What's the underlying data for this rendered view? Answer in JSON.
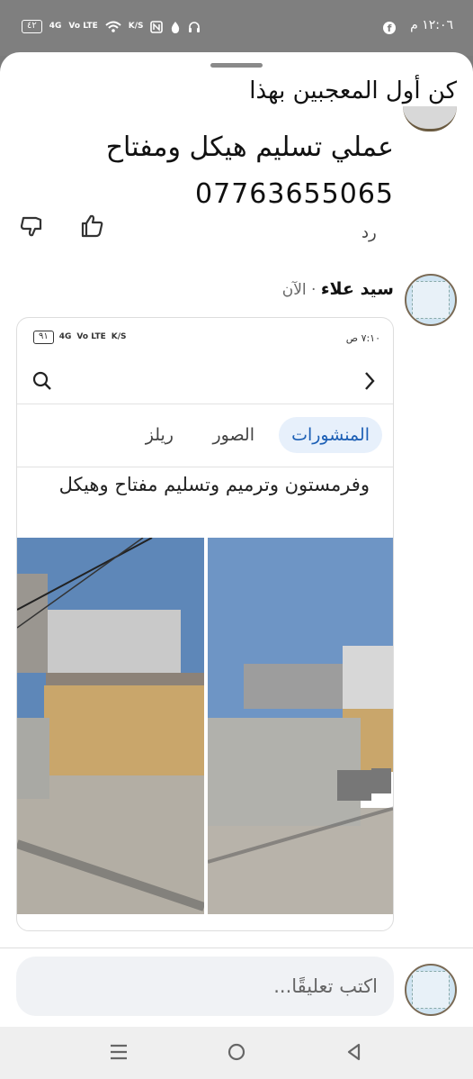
{
  "status_bar": {
    "time": "١٢:٠٦ م",
    "app_badge": "f",
    "battery": "٤٢",
    "network": "4G",
    "volte": "Vo LTE",
    "speed": "K/S"
  },
  "post": {
    "likes_prompt": "كن أول المعجبين بهذا",
    "body_line1": "عملي تسليم هيكل ومفتاح",
    "body_line2": "07763655065",
    "reply_label": "رد"
  },
  "comment": {
    "author": "سيد علاء",
    "separator": " · ",
    "time": "الآن"
  },
  "embedded_screenshot": {
    "time": "٧:١٠ ص",
    "battery": "٩١",
    "tabs": [
      "المنشورات",
      "الصور",
      "ريلز"
    ],
    "active_tab": "المنشورات",
    "post_text": "وفرمستون وترميم وتسليم مفتاح وهيكل"
  },
  "composer": {
    "placeholder": "اكتب تعليقًا..."
  },
  "colors": {
    "accent": "#1c5fb5",
    "overlay": "#7f7f7f"
  }
}
